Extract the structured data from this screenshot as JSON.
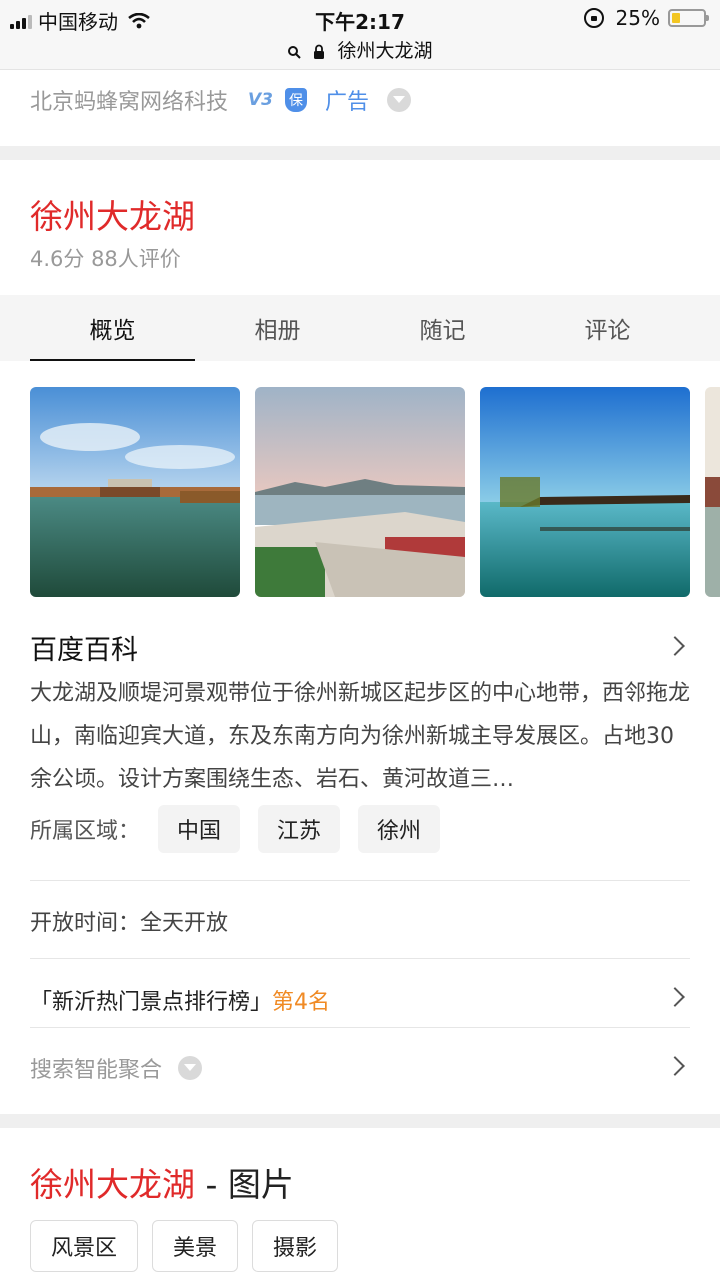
{
  "status": {
    "carrier": "中国移动",
    "time": "下午2:17",
    "url": "徐州大龙湖",
    "battery": "25%",
    "battery_level": 0.25
  },
  "ad": {
    "company": "北京蚂蜂窝网络科技",
    "v_badge": "V3",
    "bao_badge": "保",
    "ad_label": "广告"
  },
  "header": {
    "title": "徐州大龙湖",
    "rating": "4.6分 88人评价"
  },
  "tabs": [
    {
      "label": "概览"
    },
    {
      "label": "相册"
    },
    {
      "label": "随记"
    },
    {
      "label": "评论"
    }
  ],
  "baike": {
    "title": "百度百科",
    "description": "大龙湖及顺堤河景观带位于徐州新城区起步区的中心地带，西邻拖龙山，南临迎宾大道，东及东南方向为徐州新城主导发展区。占地30余公顷。设计方案围绕生态、岩石、黄河故道三…",
    "region_label": "所属区域：",
    "regions": [
      "中国",
      "江苏",
      "徐州"
    ]
  },
  "open_hours": "开放时间：全天开放",
  "ranking": {
    "name": "「新沂热门景点排行榜」",
    "position": "第4名"
  },
  "smart_search": "搜索智能聚合",
  "images_section": {
    "title_red": "徐州大龙湖",
    "title_rest": " - 图片",
    "tags": [
      "风景区",
      "美景",
      "摄影"
    ]
  }
}
